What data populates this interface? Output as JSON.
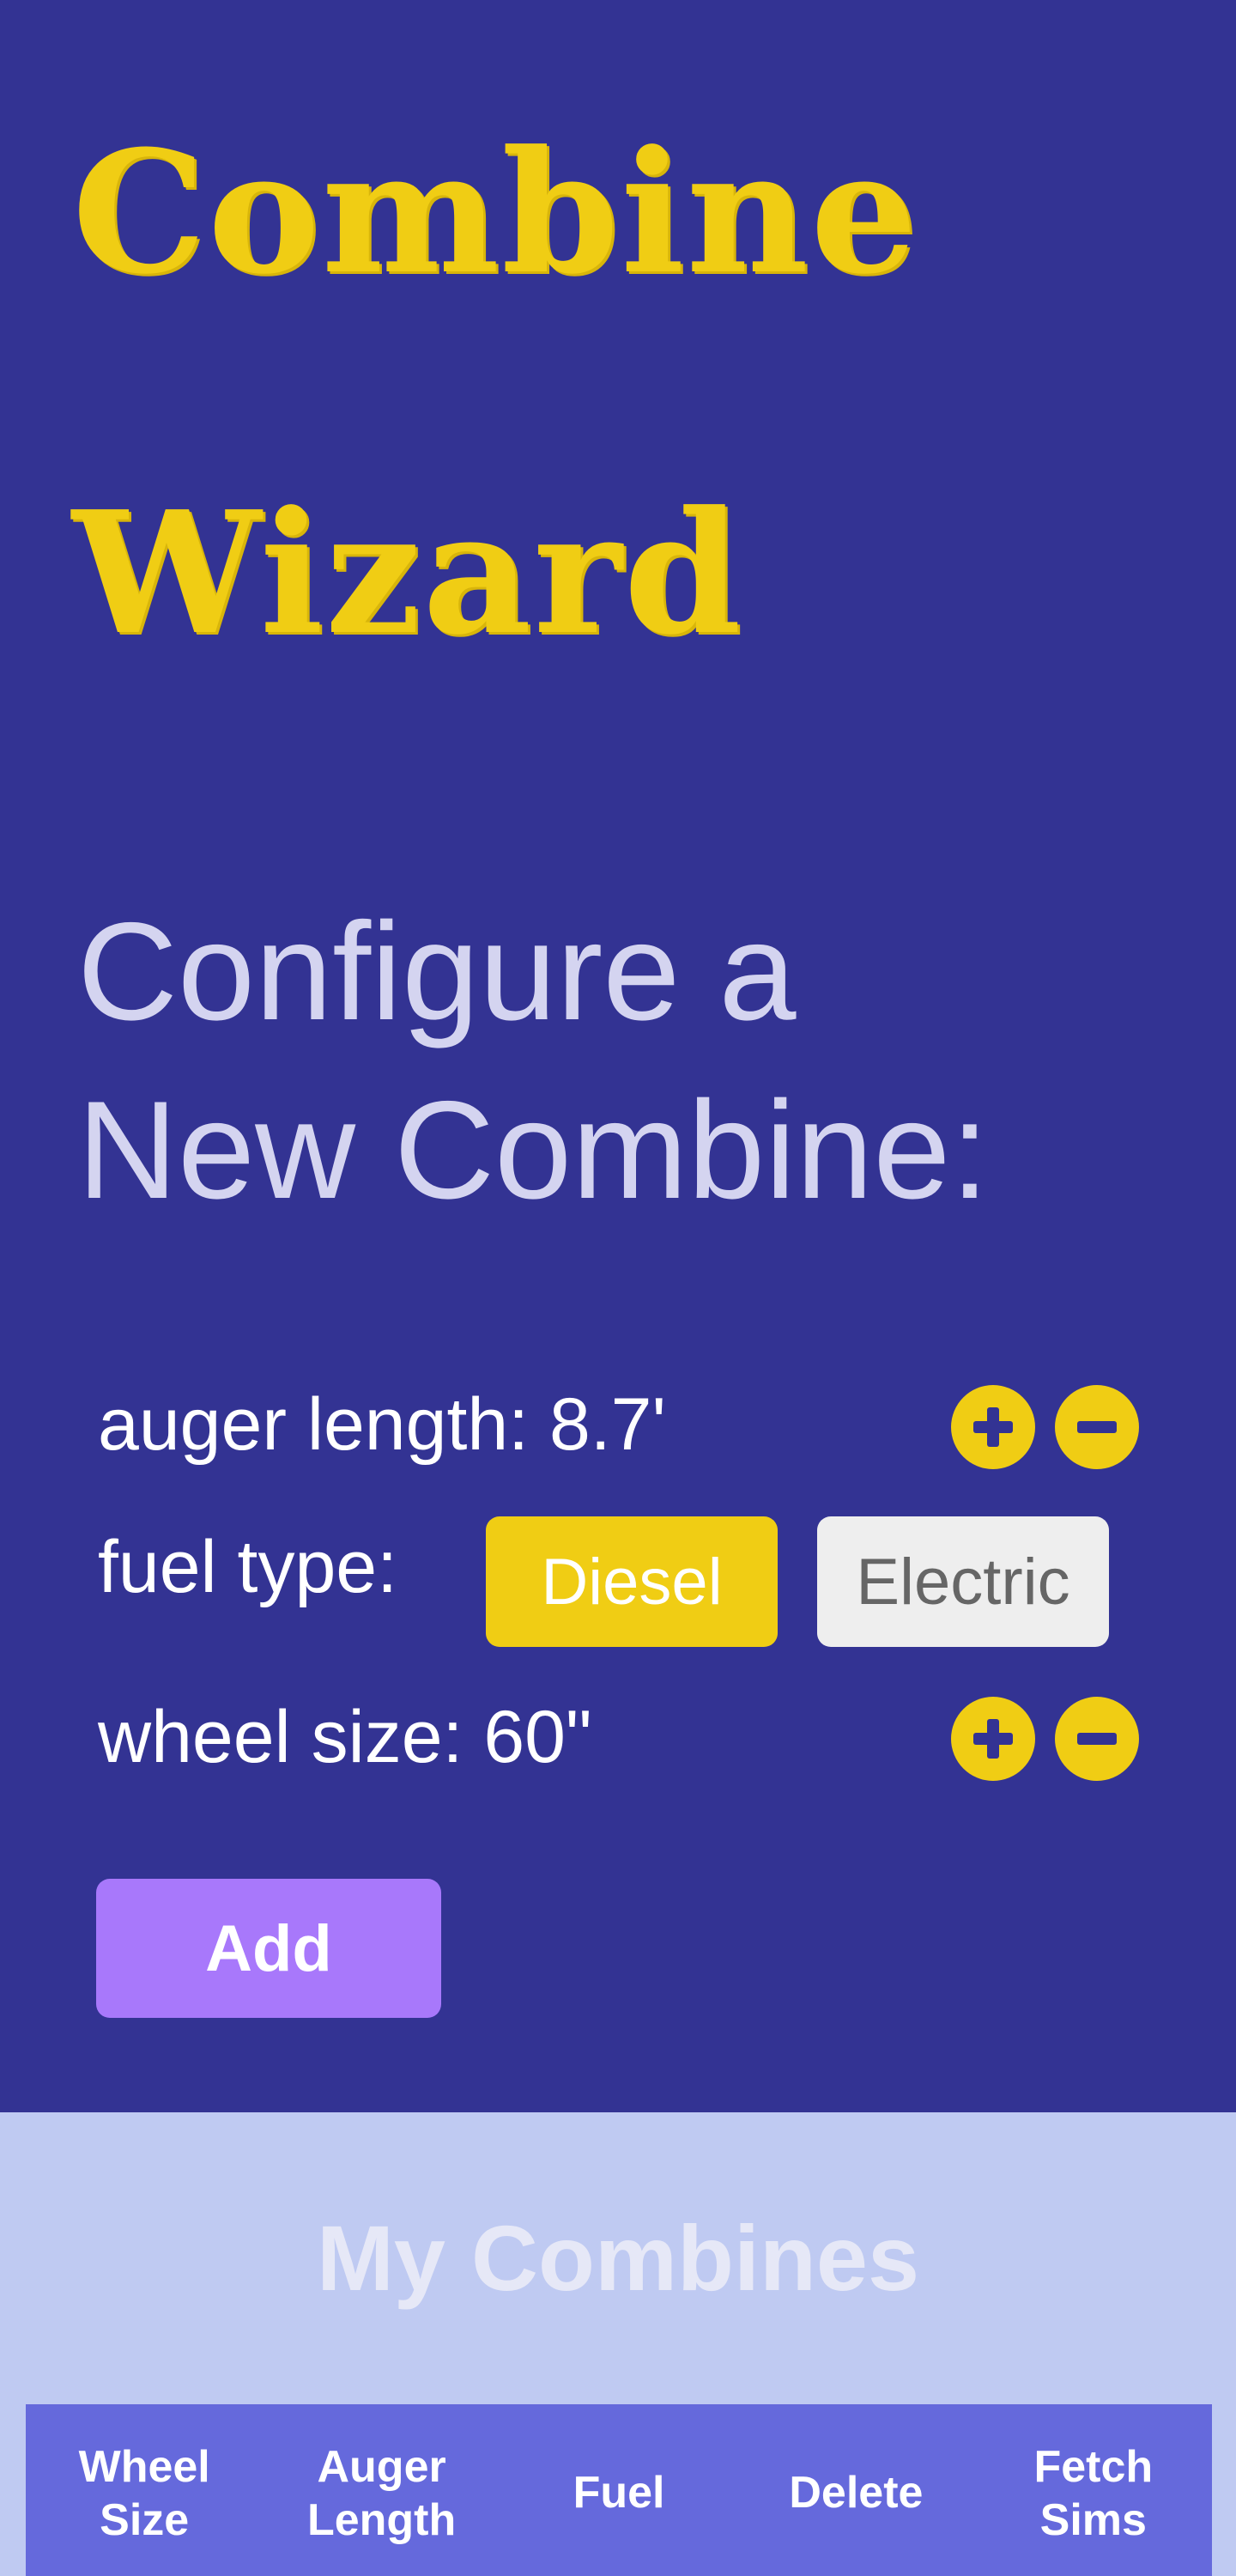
{
  "header": {
    "title_line1": "Combine",
    "title_line2": "Wizard"
  },
  "configure": {
    "heading_line1": "Configure a",
    "heading_line2": "New Combine:",
    "auger_length_label": "auger length: 8.7'",
    "fuel_type_label": "fuel type:",
    "fuel_options": [
      "Diesel",
      "Electric"
    ],
    "fuel_selected": "Diesel",
    "wheel_size_label": "wheel size: 60\"",
    "add_button_label": "Add"
  },
  "my_combines": {
    "title": "My Combines",
    "columns": [
      "Wheel\nSize",
      "Auger\nLength",
      "Fuel",
      "Delete",
      "Fetch\nSims"
    ]
  },
  "colors": {
    "top_bg": "#333393",
    "accent_yellow": "#f0cd14",
    "add_purple": "#a878fb",
    "bottom_bg": "#bfcaf2",
    "table_header": "#6569dc"
  }
}
